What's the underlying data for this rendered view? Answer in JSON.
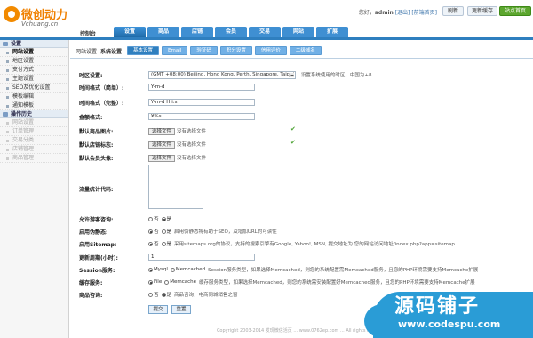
{
  "header": {
    "logo_cn": "微创动力",
    "logo_en": "Vchuang.cn",
    "greeting": "您好，",
    "username": "admin",
    "logout": "[退出]",
    "visit_home": "[前端首页]",
    "refresh": "刷新",
    "update_cache": "更新缓存",
    "site_home": "站点首页"
  },
  "nav": {
    "home": "控制台",
    "tabs": [
      "设置",
      "商品",
      "店铺",
      "会员",
      "交易",
      "网站",
      "扩展"
    ]
  },
  "sidebar": {
    "group1": "设置",
    "items1": [
      "网站设置",
      "地区设置",
      "支付方式",
      "主题设置",
      "SEO及优化设置",
      "模板编辑",
      "通知模板"
    ],
    "group2": "操作历史",
    "items2": [
      "网站设置",
      "订单管理",
      "交易分类",
      "店铺管理",
      "商品管理"
    ]
  },
  "subnav": {
    "crumb1": "网站设置",
    "crumb2": "系统设置",
    "tabs": [
      "基本设置",
      "Email",
      "验证码",
      "积分设置",
      "信用评价",
      "二级域名"
    ]
  },
  "form": {
    "timezone": {
      "label": "时区设置:",
      "value": "(GMT +08:00) Beijing, Hong Kong, Perth, Singapore, Taipei",
      "hint": "设置系统使用的时区，中国为+8"
    },
    "date_short": {
      "label": "时间格式（简单）:",
      "value": "Y-m-d"
    },
    "date_full": {
      "label": "时间格式（完整）:",
      "value": "Y-m-d H:i:s"
    },
    "currency": {
      "label": "金额格式:",
      "value": "¥%s"
    },
    "goods_img": {
      "label": "默认商品图片:",
      "button": "选择文件",
      "nofile": "没有选择文件"
    },
    "shop_logo": {
      "label": "默认店铺标志:",
      "button": "选择文件",
      "nofile": "没有选择文件"
    },
    "avatar": {
      "label": "默认会员头像:",
      "button": "选择文件",
      "nofile": "没有选择文件"
    },
    "stats_code": {
      "label": "流量统计代码:"
    },
    "guest_ask": {
      "label": "允许游客咨询:",
      "no": "否",
      "yes": "是"
    },
    "rewrite": {
      "label": "启用伪静态:",
      "no": "否",
      "yes": "是",
      "desc": "启用伪静态将有助于SEO，及增加URL的可读性"
    },
    "sitemap": {
      "label": "启用Sitemap:",
      "no": "否",
      "yes": "是",
      "desc": "采用sitemaps.org的协议，支持的搜索引擎有Google, Yahoo!, MSN, 提交地址为 您的网站访问地址/index.php?app=sitemap"
    },
    "update_cycle": {
      "label": "更新周期(小时):",
      "value": "1"
    },
    "session": {
      "label": "Session服务:",
      "opt1": "Mysql",
      "opt2": "Memcached",
      "desc": "Session服务类型，如果选择Memcached，则您的系统配置需Memcached服务，且您的PHP环境需要支持Memcache扩展"
    },
    "cache": {
      "label": "缓存服务:",
      "opt1": "File",
      "opt2": "Memcache",
      "desc": "缓存服务类型，如果选择Memcached，则您的系统需安装配置好Memcached服务，且您的PHP环境需要支持Memcache扩展"
    },
    "close_site": {
      "label": "商品咨询:",
      "no": "否",
      "yes": "是",
      "desc": "商品咨询，电商同城销售之窗"
    },
    "submit": "提交",
    "reset": "重置"
  },
  "footer": "Copyright 2003-2014 发现微信活页 ... www.0762ep.com ... All rights reserved",
  "watermark": {
    "cn": "源码铺子",
    "url": "www.codespu.com"
  },
  "colors": {
    "nav_blue": "#2f7fbf",
    "logo_orange": "#f08000",
    "watermark_blue": "#2a9cd6"
  }
}
